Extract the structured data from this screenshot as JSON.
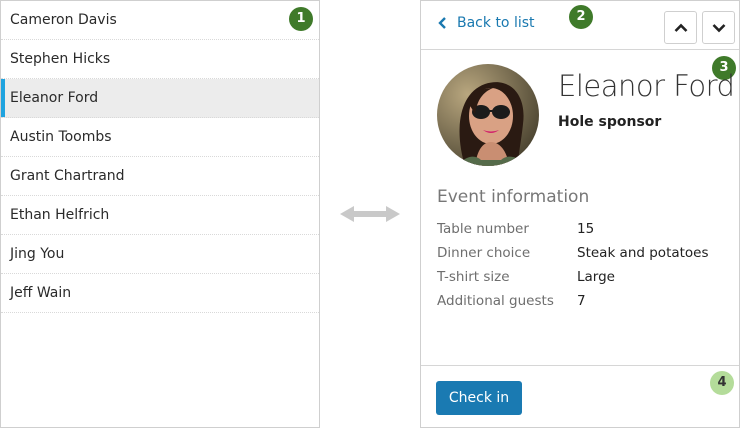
{
  "attendee_list": {
    "items": [
      {
        "name": "Cameron Davis",
        "selected": false
      },
      {
        "name": "Stephen Hicks",
        "selected": false
      },
      {
        "name": "Eleanor Ford",
        "selected": true
      },
      {
        "name": "Austin Toombs",
        "selected": false
      },
      {
        "name": "Grant Chartrand",
        "selected": false
      },
      {
        "name": "Ethan Helfrich",
        "selected": false
      },
      {
        "name": "Jing You",
        "selected": false
      },
      {
        "name": "Jeff Wain",
        "selected": false
      }
    ]
  },
  "markers": {
    "m1": "1",
    "m2": "2",
    "m3": "3",
    "m4": "4"
  },
  "detail": {
    "back_label": "Back to list",
    "up_icon": "chevron-up-icon",
    "down_icon": "chevron-down-icon",
    "name": "Eleanor Ford",
    "role": "Hole sponsor",
    "section_title": "Event information",
    "fields": [
      {
        "label": "Table number",
        "value": "15"
      },
      {
        "label": "Dinner choice",
        "value": "Steak and potatoes"
      },
      {
        "label": "T-shirt size",
        "value": "Large"
      },
      {
        "label": "Additional guests",
        "value": "7"
      }
    ],
    "checkin_label": "Check in"
  },
  "colors": {
    "accent": "#1a7ab2",
    "selection_bar": "#1fa3df",
    "marker_dark": "#3f7a2a",
    "marker_light": "#b4dc9a"
  }
}
